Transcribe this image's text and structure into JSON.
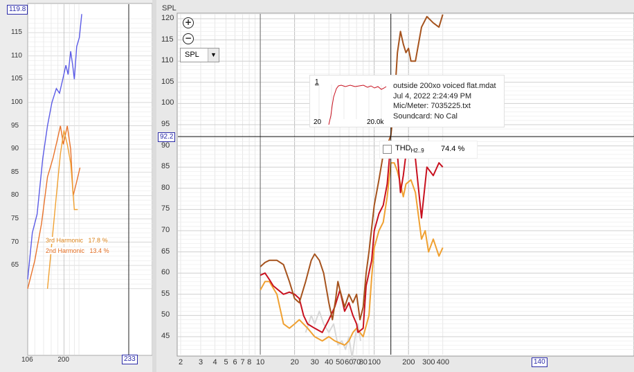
{
  "left_panel": {
    "cursor_y_label": "119.8",
    "cursor_x_label": "233",
    "y_ticks": [
      "115",
      "110",
      "105",
      "100",
      "95",
      "90",
      "85",
      "80",
      "75",
      "70",
      "65"
    ],
    "x_ticks": [
      "106",
      "200"
    ],
    "harmonic_labels": [
      {
        "name": "3rd Harmonic",
        "value": "17.8 %",
        "color": "#e8a23a"
      },
      {
        "name": "2nd Harmonic",
        "value": "13.4 %",
        "color": "#e06a1e"
      }
    ]
  },
  "main_panel": {
    "y_axis_title": "SPL",
    "cursor_y_label": "92.2",
    "cursor_x_label": "140",
    "y_ticks": [
      "120",
      "115",
      "110",
      "105",
      "100",
      "95",
      "90",
      "85",
      "80",
      "75",
      "70",
      "65",
      "60",
      "55",
      "50",
      "45"
    ],
    "x_ticks": [
      "2",
      "3",
      "4",
      "5",
      "6",
      "7",
      "8",
      "10",
      "20",
      "30",
      "40",
      "50",
      "60",
      "70",
      "80",
      "100",
      "200",
      "300",
      "400"
    ],
    "zoom_in_icon": "plus-circle-icon",
    "zoom_out_icon": "minus-circle-icon",
    "select_value": "SPL",
    "info": {
      "thumb_index": "1",
      "thumb_x_start": "20",
      "thumb_x_end": "20.0k",
      "lines": [
        "outside 200xo voiced flat.mdat",
        "Jul 4, 2022 2:24:49 PM",
        "Mic/Meter: 7035225.txt",
        "Soundcard: No Cal"
      ]
    },
    "thd": {
      "label": "THD",
      "subscript": "H2..9",
      "value": "74.4 %"
    }
  },
  "colors": {
    "blue_trace": "#5a5ae6",
    "orange2": "#e8722a",
    "orange3": "#f0a030",
    "brown": "#a5521c",
    "red": "#c8101e",
    "grey_trace": "#d8d8d8",
    "cursor_blue": "#2a2aa8"
  },
  "chart_data": [
    {
      "type": "line",
      "title": "",
      "xlabel": "",
      "ylabel": "",
      "x_scale": "log",
      "ylim": [
        60,
        120
      ],
      "series": [
        {
          "name": "",
          "color": "#5a5ae6",
          "points": [
            [
              106,
              62
            ],
            [
              115,
              72
            ],
            [
              125,
              76
            ],
            [
              138,
              88
            ],
            [
              150,
              95
            ],
            [
              162,
              100
            ],
            [
              175,
              103
            ],
            [
              185,
              102
            ],
            [
              196,
              105
            ],
            [
              207,
              108
            ],
            [
              215,
              106
            ],
            [
              225,
              111
            ],
            [
              233,
              108
            ],
            [
              240,
              105
            ],
            [
              250,
              112
            ],
            [
              262,
              114
            ],
            [
              273,
              119
            ]
          ]
        },
        {
          "name": "2nd Harmonic",
          "color": "#e8722a",
          "points": [
            [
              106,
              60
            ],
            [
              120,
              66
            ],
            [
              135,
              74
            ],
            [
              150,
              84
            ],
            [
              165,
              88
            ],
            [
              178,
              92
            ],
            [
              188,
              95
            ],
            [
              198,
              91
            ],
            [
              212,
              95
            ],
            [
              225,
              90
            ],
            [
              235,
              80
            ],
            [
              250,
              83
            ],
            [
              265,
              86
            ]
          ]
        },
        {
          "name": "3rd Harmonic",
          "color": "#f0a030",
          "points": [
            [
              150,
              60
            ],
            [
              162,
              70
            ],
            [
              175,
              80
            ],
            [
              188,
              89
            ],
            [
              200,
              94
            ],
            [
              212,
              91
            ],
            [
              225,
              87
            ],
            [
              240,
              77
            ],
            [
              255,
              77
            ]
          ]
        }
      ]
    },
    {
      "type": "line",
      "title": "",
      "xlabel": "",
      "ylabel": "SPL",
      "x_scale": "log",
      "xlim": [
        2,
        400
      ],
      "ylim": [
        42,
        122
      ],
      "series": [
        {
          "name": "",
          "color": "#a5521c",
          "points": [
            [
              10,
              61.5
            ],
            [
              11,
              62.5
            ],
            [
              12,
              63
            ],
            [
              14,
              63
            ],
            [
              16,
              62
            ],
            [
              18,
              58
            ],
            [
              20,
              54
            ],
            [
              22,
              53
            ],
            [
              25,
              58
            ],
            [
              28,
              63
            ],
            [
              30,
              64.5
            ],
            [
              33,
              63
            ],
            [
              36,
              60
            ],
            [
              40,
              53
            ],
            [
              43,
              49
            ],
            [
              46,
              54
            ],
            [
              48,
              58
            ],
            [
              50,
              56
            ],
            [
              55,
              52
            ],
            [
              60,
              55
            ],
            [
              65,
              53
            ],
            [
              70,
              55
            ],
            [
              75,
              49
            ],
            [
              80,
              52
            ],
            [
              85,
              60
            ],
            [
              90,
              65
            ],
            [
              100,
              76
            ],
            [
              110,
              82
            ],
            [
              120,
              88
            ],
            [
              130,
              90
            ],
            [
              140,
              92.5
            ],
            [
              150,
              100
            ],
            [
              160,
              112
            ],
            [
              170,
              117
            ],
            [
              180,
              114
            ],
            [
              190,
              112
            ],
            [
              200,
              113
            ],
            [
              210,
              110
            ],
            [
              230,
              110
            ],
            [
              260,
              118
            ],
            [
              290,
              120.5
            ],
            [
              330,
              119
            ],
            [
              370,
              118
            ],
            [
              400,
              121
            ]
          ]
        },
        {
          "name": "",
          "color": "#c8101e",
          "points": [
            [
              10,
              59.5
            ],
            [
              11,
              60
            ],
            [
              12,
              58.5
            ],
            [
              13,
              57
            ],
            [
              16,
              55
            ],
            [
              18,
              55.5
            ],
            [
              20,
              55
            ],
            [
              22,
              54
            ],
            [
              24,
              50
            ],
            [
              26,
              48
            ],
            [
              30,
              47
            ],
            [
              35,
              46
            ],
            [
              40,
              49
            ],
            [
              45,
              52
            ],
            [
              50,
              56
            ],
            [
              55,
              51
            ],
            [
              60,
              53
            ],
            [
              65,
              50
            ],
            [
              70,
              48
            ],
            [
              72,
              46
            ],
            [
              80,
              47
            ],
            [
              85,
              57
            ],
            [
              95,
              63
            ],
            [
              100,
              70
            ],
            [
              110,
              74
            ],
            [
              120,
              76
            ],
            [
              130,
              81
            ],
            [
              140,
              91
            ],
            [
              150,
              91
            ],
            [
              160,
              88
            ],
            [
              170,
              79
            ],
            [
              180,
              83
            ],
            [
              190,
              88
            ],
            [
              210,
              90
            ],
            [
              230,
              87
            ],
            [
              260,
              73
            ],
            [
              290,
              85
            ],
            [
              330,
              83
            ],
            [
              370,
              86
            ],
            [
              400,
              85
            ]
          ]
        },
        {
          "name": "",
          "color": "#f0a030",
          "points": [
            [
              10,
              56
            ],
            [
              11,
              58
            ],
            [
              12,
              58
            ],
            [
              14,
              55
            ],
            [
              16,
              48
            ],
            [
              18,
              47
            ],
            [
              20,
              48
            ],
            [
              22,
              49
            ],
            [
              26,
              47
            ],
            [
              30,
              45
            ],
            [
              35,
              44
            ],
            [
              40,
              45
            ],
            [
              45,
              44
            ],
            [
              55,
              43
            ],
            [
              60,
              44
            ],
            [
              65,
              46
            ],
            [
              70,
              47
            ],
            [
              80,
              45
            ],
            [
              90,
              50
            ],
            [
              95,
              59
            ],
            [
              100,
              66
            ],
            [
              110,
              70
            ],
            [
              120,
              72
            ],
            [
              130,
              78
            ],
            [
              140,
              86
            ],
            [
              150,
              86
            ],
            [
              160,
              84
            ],
            [
              170,
              81
            ],
            [
              180,
              78
            ],
            [
              190,
              81
            ],
            [
              210,
              82
            ],
            [
              230,
              79
            ],
            [
              260,
              68
            ],
            [
              280,
              70
            ],
            [
              300,
              65
            ],
            [
              330,
              68
            ],
            [
              370,
              64
            ],
            [
              400,
              66
            ]
          ]
        },
        {
          "name": "",
          "color": "#d8d8d8",
          "points": [
            [
              25,
              46
            ],
            [
              28,
              50
            ],
            [
              30,
              48
            ],
            [
              33,
              51
            ],
            [
              36,
              48
            ],
            [
              40,
              46
            ],
            [
              44,
              48
            ],
            [
              48,
              43
            ],
            [
              52,
              44
            ],
            [
              56,
              42
            ],
            [
              60,
              45
            ],
            [
              64,
              40
            ],
            [
              68,
              45
            ],
            [
              72,
              48
            ],
            [
              76,
              44
            ]
          ]
        }
      ]
    }
  ]
}
